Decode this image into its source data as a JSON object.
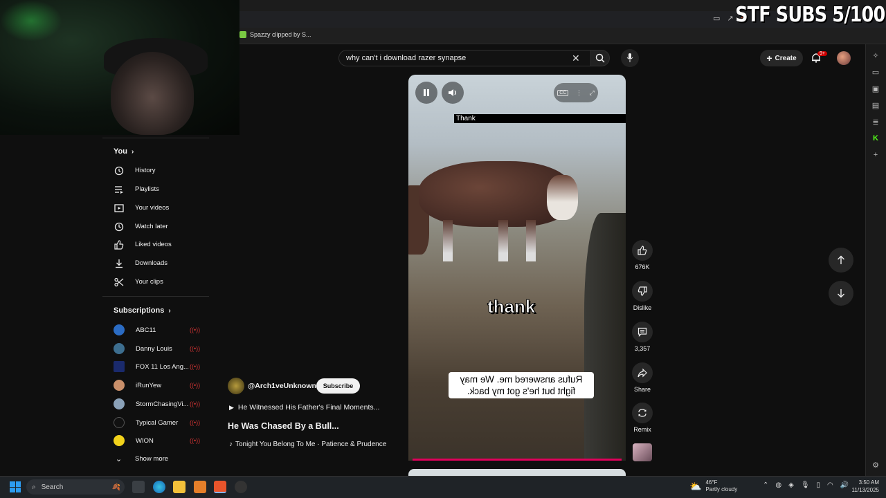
{
  "overlay": {
    "text": "STF SUBS 5/100"
  },
  "bookmarks": [
    {
      "label": "Spazzy clipped by S..."
    }
  ],
  "search": {
    "query": "why can't i download razer synapse"
  },
  "header": {
    "create_label": "Create",
    "notif_count": "9+"
  },
  "leftnav": {
    "you_label": "You",
    "items": [
      {
        "label": "History",
        "icon": "history-icon"
      },
      {
        "label": "Playlists",
        "icon": "playlists-icon"
      },
      {
        "label": "Your videos",
        "icon": "your-videos-icon"
      },
      {
        "label": "Watch later",
        "icon": "clock-icon"
      },
      {
        "label": "Liked videos",
        "icon": "thumbs-up-icon"
      },
      {
        "label": "Downloads",
        "icon": "download-icon"
      },
      {
        "label": "Your clips",
        "icon": "scissors-icon"
      }
    ],
    "subscriptions_label": "Subscriptions",
    "subscriptions": [
      {
        "name": "ABC11",
        "color": "#2b6cc4"
      },
      {
        "name": "Danny Louis",
        "color": "#3d6e8f"
      },
      {
        "name": "FOX 11 Los Ang...",
        "color": "#1a2a6c"
      },
      {
        "name": "iRunYew",
        "color": "#c98f6a"
      },
      {
        "name": "StormChasingVi...",
        "color": "#8aa1b8"
      },
      {
        "name": "Typical Gamer",
        "color": "#111111"
      },
      {
        "name": "WION",
        "color": "#f2d21b"
      }
    ],
    "show_more": "Show more"
  },
  "video": {
    "caption_bar": "Thank",
    "caption_big": "thank",
    "caption_mirror": "Rufus answered me. We may fight but he's got my back."
  },
  "actions": {
    "likes": "676K",
    "dislike_label": "Dislike",
    "comments": "3,357",
    "share_label": "Share",
    "remix_label": "Remix"
  },
  "channel": {
    "handle": "@Arch1veUnknown",
    "subscribe_label": "Subscribe",
    "playlist_line": "He Witnessed His Father's Final Moments...",
    "title": "He Was Chased By a Bull...",
    "music": "Tonight You Belong To Me · Patience & Prudence"
  },
  "taskbar": {
    "search_placeholder": "Search",
    "weather_temp": "46°F",
    "weather_desc": "Partly cloudy",
    "time": "3:50 AM",
    "date": "11/13/2025"
  },
  "colors": {
    "accent": "#e0005a",
    "live": "#cc3333",
    "subscribe_bg": "#f1f1f1"
  }
}
